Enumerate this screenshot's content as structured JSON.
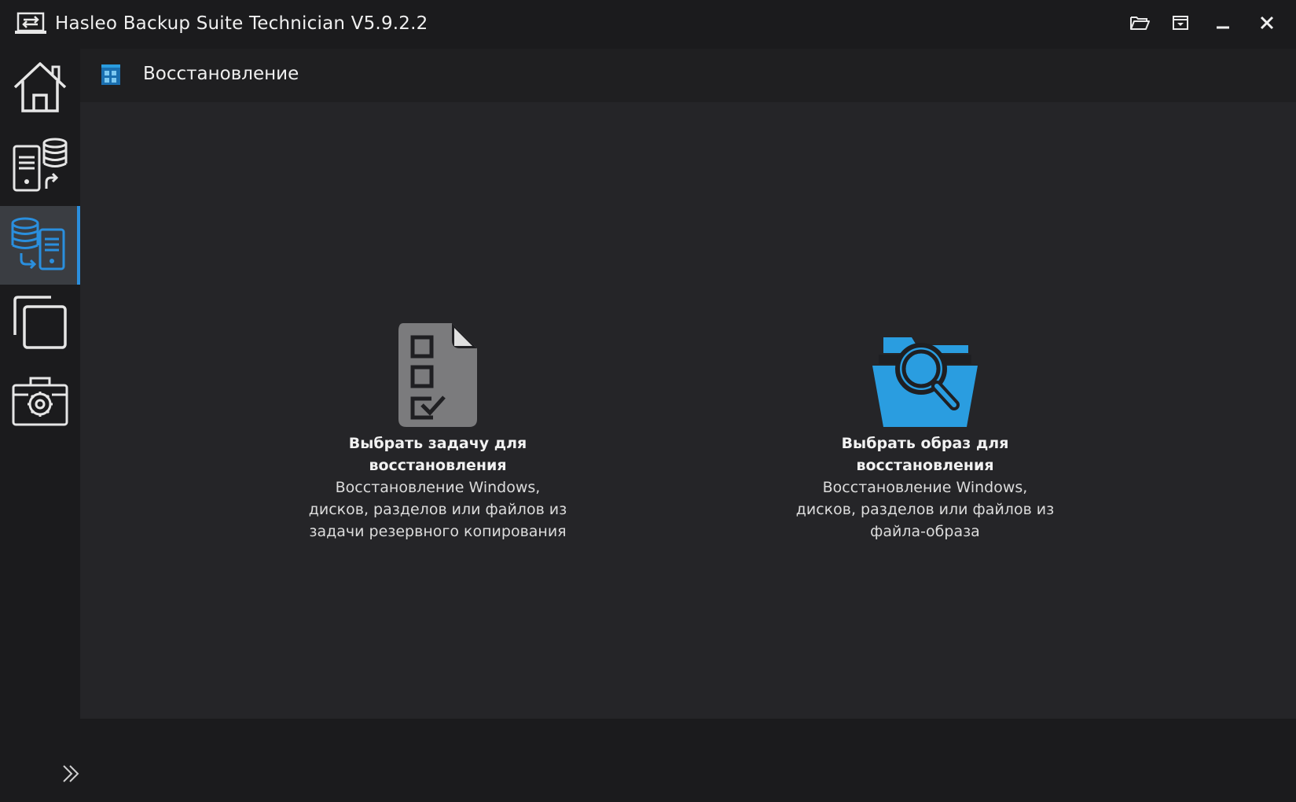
{
  "window": {
    "title": "Hasleo Backup Suite Technician V5.9.2.2",
    "controls": [
      "open-folder-icon",
      "minimize-to-tray-icon",
      "minimize-icon",
      "close-icon"
    ]
  },
  "sidebar": {
    "items": [
      {
        "id": "home",
        "icon": "home-icon",
        "active": false
      },
      {
        "id": "backup",
        "icon": "backup-icon",
        "active": false
      },
      {
        "id": "restore",
        "icon": "restore-icon",
        "active": true
      },
      {
        "id": "clone",
        "icon": "clone-icon",
        "active": false
      },
      {
        "id": "tools",
        "icon": "tools-icon",
        "active": false
      }
    ],
    "expand_icon": "double-chevron-right-icon"
  },
  "header": {
    "icon": "grid-icon",
    "title": "Восстановление"
  },
  "options": [
    {
      "icon": "checklist-document-icon",
      "title": "Выбрать задачу для восстановления",
      "description": "Восстановление Windows, дисков, разделов или файлов из задачи резервного копирования"
    },
    {
      "icon": "folder-search-icon",
      "title": "Выбрать образ для восстановления",
      "description": "Восстановление Windows, дисков, разделов или файлов из файла-образа"
    }
  ],
  "colors": {
    "accent": "#2a8fde",
    "folder_blue": "#2a9de0",
    "background": "#1b1b1d",
    "content_bg": "#252528"
  }
}
